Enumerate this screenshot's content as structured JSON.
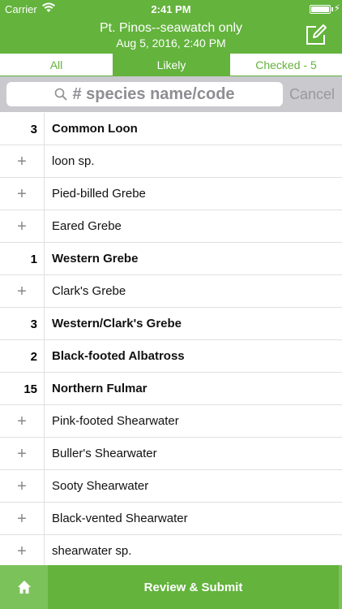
{
  "status_bar": {
    "carrier": "Carrier",
    "time": "2:41 PM"
  },
  "header": {
    "title": "Pt. Pinos--seawatch only",
    "subtitle": "Aug 5, 2016, 2:40 PM",
    "edit_icon": "edit-icon"
  },
  "tabs": [
    {
      "label": "All"
    },
    {
      "label": "Likely"
    },
    {
      "label": "Checked - 5"
    }
  ],
  "search": {
    "placeholder": "# species name/code",
    "cancel_label": "Cancel"
  },
  "species": [
    {
      "count": "3",
      "name": "Common Loon",
      "checked": true
    },
    {
      "count": "+",
      "name": "loon sp.",
      "checked": false
    },
    {
      "count": "+",
      "name": "Pied-billed Grebe",
      "checked": false
    },
    {
      "count": "+",
      "name": "Eared Grebe",
      "checked": false
    },
    {
      "count": "1",
      "name": "Western Grebe",
      "checked": true
    },
    {
      "count": "+",
      "name": "Clark's Grebe",
      "checked": false
    },
    {
      "count": "3",
      "name": "Western/Clark's Grebe",
      "checked": true
    },
    {
      "count": "2",
      "name": "Black-footed Albatross",
      "checked": true
    },
    {
      "count": "15",
      "name": "Northern Fulmar",
      "checked": true
    },
    {
      "count": "+",
      "name": "Pink-footed Shearwater",
      "checked": false
    },
    {
      "count": "+",
      "name": "Buller's Shearwater",
      "checked": false
    },
    {
      "count": "+",
      "name": "Sooty Shearwater",
      "checked": false
    },
    {
      "count": "+",
      "name": "Black-vented Shearwater",
      "checked": false
    },
    {
      "count": "+",
      "name": "shearwater sp.",
      "checked": false
    }
  ],
  "bottom": {
    "review_label": "Review & Submit",
    "home_icon": "home-icon"
  },
  "colors": {
    "accent": "#63b33c",
    "tab_active_text": "#ffffff"
  }
}
